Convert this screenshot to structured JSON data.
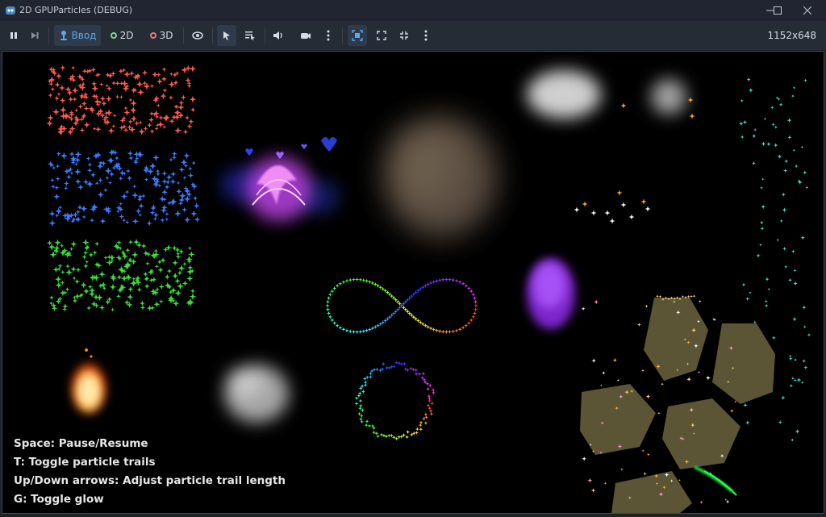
{
  "window": {
    "title": "2D GPUParticles (DEBUG)"
  },
  "toolbar": {
    "input_label": "Ввод",
    "mode_2d_label": "2D",
    "mode_3d_label": "3D",
    "resolution": "1152x648"
  },
  "help_lines": [
    "Space: Pause/Resume",
    "T: Toggle particle trails",
    "Up/Down arrows: Adjust particle trail length",
    "G: Toggle glow"
  ],
  "colors": {
    "accent": "#5fa8e8",
    "ring_2d": "#7bd48a",
    "ring_3d": "#f07878",
    "text_red": "#ff5a4a",
    "text_blue": "#3a7bff",
    "text_green": "#3cdc3c",
    "rock": "#5b5535"
  }
}
